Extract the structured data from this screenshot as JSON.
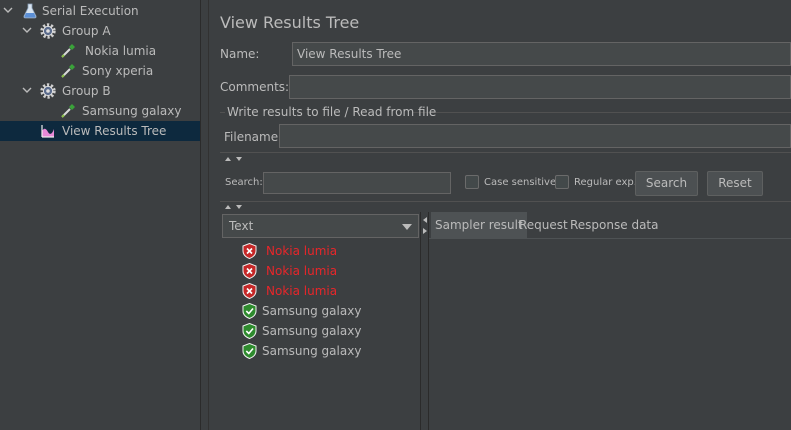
{
  "tree": {
    "items": [
      {
        "label": "Serial Execution"
      },
      {
        "label": "Group A"
      },
      {
        "label": "Nokia lumia"
      },
      {
        "label": "Sony xperia"
      },
      {
        "label": "Group B"
      },
      {
        "label": "Samsung galaxy"
      },
      {
        "label": "View Results Tree"
      }
    ]
  },
  "panel": {
    "title": "View Results Tree",
    "name_label": "Name:",
    "name_value": "View Results Tree",
    "comments_label": "Comments:",
    "comments_value": "",
    "file_group_label": "Write results to file / Read from file",
    "filename_label": "Filename",
    "filename_value": ""
  },
  "search": {
    "label": "Search:",
    "value": "",
    "case_sensitive_label": "Case sensitive",
    "regex_label": "Regular exp.",
    "search_button": "Search",
    "reset_button": "Reset"
  },
  "results": {
    "renderer": "Text",
    "items": [
      {
        "label": "Nokia lumia",
        "status": "fail"
      },
      {
        "label": "Nokia lumia",
        "status": "fail"
      },
      {
        "label": "Nokia lumia",
        "status": "fail"
      },
      {
        "label": "Samsung galaxy",
        "status": "pass"
      },
      {
        "label": "Samsung galaxy",
        "status": "pass"
      },
      {
        "label": "Samsung galaxy",
        "status": "pass"
      }
    ]
  },
  "tabs": [
    {
      "label": "Sampler result"
    },
    {
      "label": "Request"
    },
    {
      "label": "Response data"
    }
  ],
  "colors": {
    "background": "#3c3f41",
    "selection": "#0d293e",
    "fail_text": "#e8262a",
    "pass_icon": "#2e8b2e",
    "fail_icon": "#c62828"
  }
}
